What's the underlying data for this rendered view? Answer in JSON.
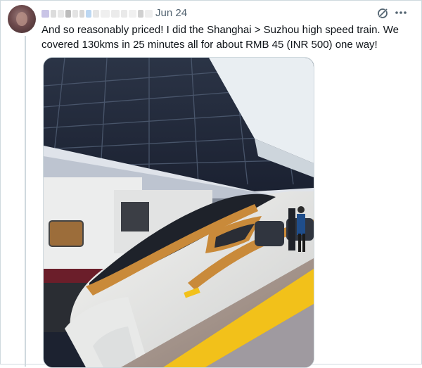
{
  "tweet": {
    "date": "Jun 24",
    "text": "And so reasonably priced! I did the Shanghai > Suzhou high speed train. We covered 130kms in 25 minutes all for about RMB 45 (INR 500) one way!",
    "author_redacted": true
  },
  "icons": {
    "grok": "grok-icon",
    "more": "more-icon"
  },
  "media": {
    "type": "photo",
    "subject": "high speed train at platform"
  },
  "colors": {
    "text": "#0f1419",
    "secondary": "#536471",
    "border": "#cfd9de",
    "platform_yellow": "#f2c11a",
    "train_accent": "#c98a3a"
  }
}
